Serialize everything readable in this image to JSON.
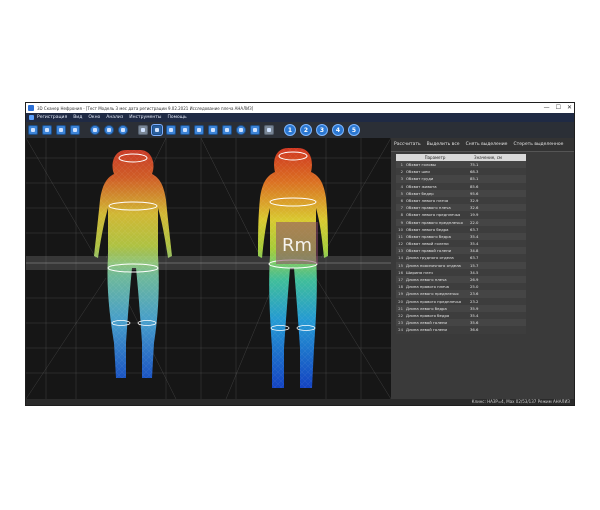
{
  "window": {
    "title": "3D Сканер Нефрония - [Тест Модель 3 мес дата регистрации 9.02.2021 Исследование плеча АНАЛИЗ]",
    "controls": [
      "—",
      "☐",
      "✕"
    ]
  },
  "menu": [
    "Регистрация",
    "Вид",
    "Окно",
    "Анализ",
    "Инструменты",
    "Помощь"
  ],
  "toolbar": {
    "numbers": [
      "1",
      "2",
      "3",
      "4",
      "5"
    ]
  },
  "viewport": {
    "watermark": "Rm"
  },
  "panel": {
    "tabs": [
      "Рассчитать",
      "Выделить все",
      "Снять выделение",
      "Стереть выделенное"
    ],
    "table_headers": {
      "param": "Параметр",
      "value": "Значение, см"
    },
    "rows": [
      {
        "n": "1",
        "param": "Обхват головы",
        "value": "75.1"
      },
      {
        "n": "2",
        "param": "Обхват шеи",
        "value": "68.3"
      },
      {
        "n": "3",
        "param": "Обхват груди",
        "value": "85.1"
      },
      {
        "n": "4",
        "param": "Обхват живота",
        "value": "85.6"
      },
      {
        "n": "5",
        "param": "Обхват бедер",
        "value": "95.6"
      },
      {
        "n": "6",
        "param": "Обхват левого плеча",
        "value": "32.9"
      },
      {
        "n": "7",
        "param": "Обхват правого плеча",
        "value": "32.6"
      },
      {
        "n": "8",
        "param": "Обхват левого предплечья",
        "value": "19.9"
      },
      {
        "n": "9",
        "param": "Обхват правого предплечья",
        "value": "22.0"
      },
      {
        "n": "10",
        "param": "Обхват левого бедра",
        "value": "63.7"
      },
      {
        "n": "11",
        "param": "Обхват правого бедра",
        "value": "35.4"
      },
      {
        "n": "12",
        "param": "Обхват левой голени",
        "value": "35.4"
      },
      {
        "n": "13",
        "param": "Обхват правой голени",
        "value": "34.8"
      },
      {
        "n": "14",
        "param": "Длина грудного отдела",
        "value": "63.7"
      },
      {
        "n": "15",
        "param": "Длина поясничного отдела",
        "value": "15.7"
      },
      {
        "n": "16",
        "param": "Ширина плеч",
        "value": "34.5"
      },
      {
        "n": "17",
        "param": "Длина левого плеча",
        "value": "26.9"
      },
      {
        "n": "18",
        "param": "Длина правого плеча",
        "value": "25.0"
      },
      {
        "n": "19",
        "param": "Длина левого предплечья",
        "value": "23.6"
      },
      {
        "n": "20",
        "param": "Длина правого предплечья",
        "value": "23.2"
      },
      {
        "n": "21",
        "param": "Длина левого бедра",
        "value": "35.9"
      },
      {
        "n": "22",
        "param": "Длина правого бедра",
        "value": "35.4"
      },
      {
        "n": "23",
        "param": "Длина левой голени",
        "value": "35.6"
      },
      {
        "n": "24",
        "param": "Длина левой голени",
        "value": "36.6"
      }
    ]
  },
  "status": "Клинс: НАЗР=4, Мах 02/53/137 Режим АНАЛИЗ"
}
